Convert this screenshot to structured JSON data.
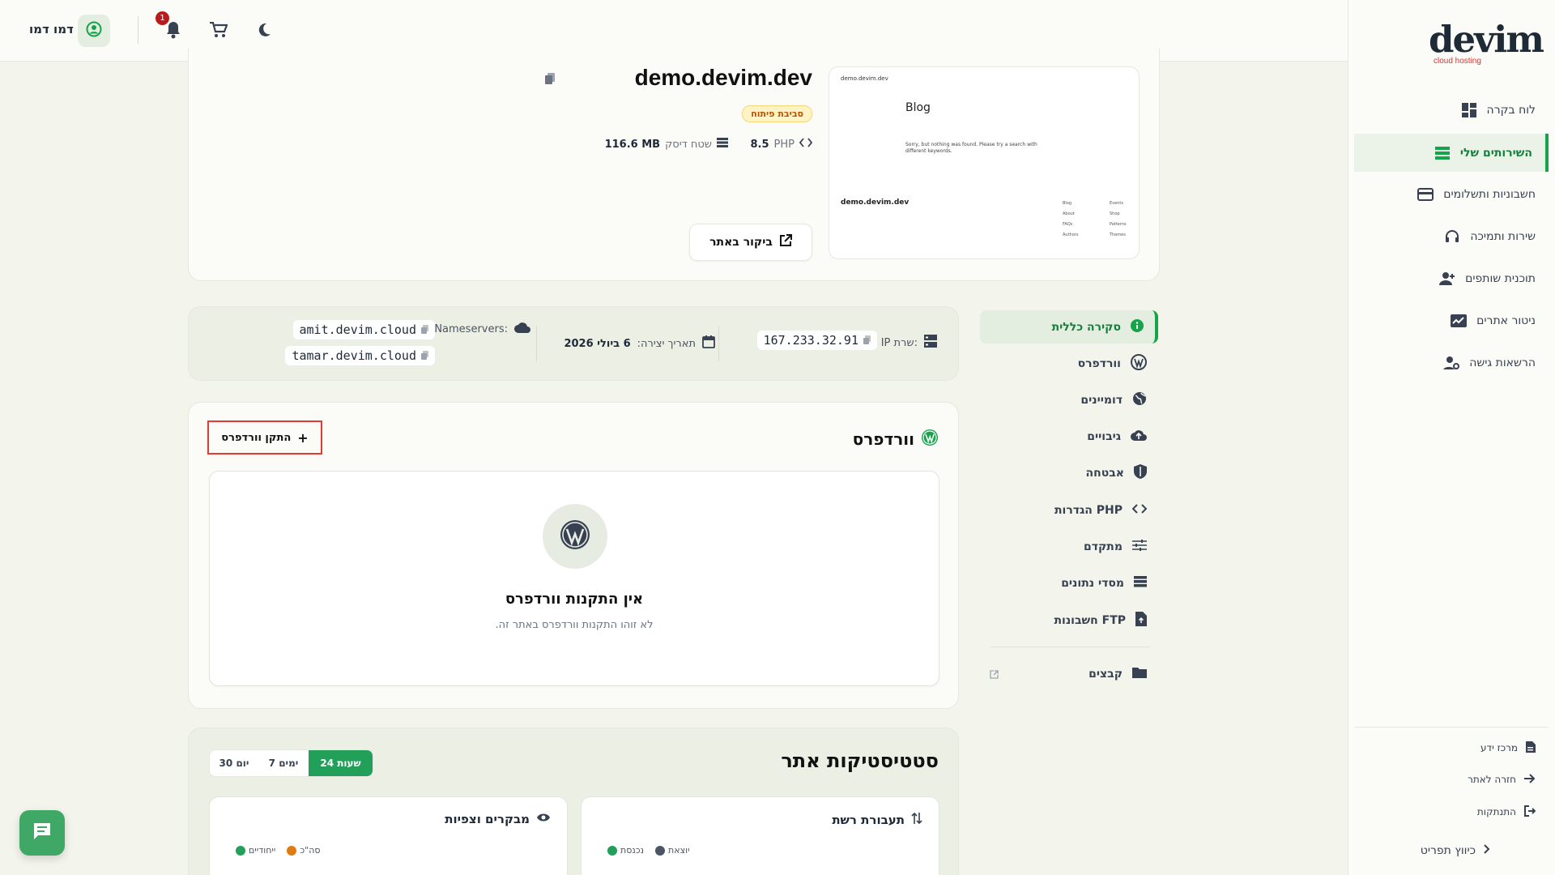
{
  "app": {
    "logo_text": "devim",
    "logo_sub": "cloud hosting"
  },
  "sidebar": {
    "items": [
      {
        "label": "לוח בקרה",
        "icon": "dashboard-icon"
      },
      {
        "label": "השירותים שלי",
        "icon": "services-icon"
      },
      {
        "label": "חשבוניות ותשלומים",
        "icon": "credit-card-icon"
      },
      {
        "label": "שירות ותמיכה",
        "icon": "headset-icon"
      },
      {
        "label": "תוכנית שותפים",
        "icon": "add-user-icon"
      },
      {
        "label": "ניטור אתרים",
        "icon": "monitor-chart-icon"
      },
      {
        "label": "הרשאות גישה",
        "icon": "user-gear-icon"
      }
    ],
    "footer": [
      {
        "label": "מרכז ידע"
      },
      {
        "label": "חזרה לאתר"
      },
      {
        "label": "התנתקות"
      }
    ],
    "collapse_label": "כיווץ תפריט"
  },
  "topbar": {
    "user_name": "דמו דמו",
    "notification_count": "1"
  },
  "site": {
    "domain": "demo.devim.dev",
    "env_badge": "סביבת פיתוח",
    "php_label": "PHP",
    "php_version": "8.5",
    "disk_label": "שטח דיסק",
    "disk_value": "116.6 MB",
    "visit_label": "ביקור באתר",
    "preview": {
      "site_small": "demo.devim.dev",
      "blog_title": "Blog",
      "blog_text": "Sorry, but nothing was found. Please try a search with different keywords.",
      "footer_site": "demo.devim.dev",
      "links_a": [
        "Blog",
        "About",
        "FAQs",
        "Authors"
      ],
      "links_b": [
        "Events",
        "Shop",
        "Patterns",
        "Themes"
      ]
    }
  },
  "info": {
    "ip_label": "IP שרת:",
    "ip_value": "167.233.32.91",
    "created_label": "תאריך יצירה:",
    "created_value": "6 ביולי 2026",
    "ns_label": "Nameservers:",
    "ns_values": [
      "amit.devim.cloud",
      "tamar.devim.cloud"
    ]
  },
  "submenu": [
    {
      "label": "סקירה כללית"
    },
    {
      "label": "וורדפרס"
    },
    {
      "label": "דומיינים"
    },
    {
      "label": "גיבויים"
    },
    {
      "label": "אבטחה"
    },
    {
      "label": "הגדרות PHP"
    },
    {
      "label": "מתקדם"
    },
    {
      "label": "מסדי נתונים"
    },
    {
      "label": "חשבונות FTP"
    },
    {
      "label": "קבצים"
    }
  ],
  "wordpress": {
    "title": "וורדפרס",
    "install_button": "התקן וורדפרס",
    "empty_title": "אין התקנות וורדפרס",
    "empty_text": "לא זוהו התקנות וורדפרס באתר זה."
  },
  "stats": {
    "title": "סטטיסטיקות אתר",
    "ranges": [
      "30 יום",
      "7 ימים",
      "24 שעות"
    ],
    "active_range": "24 שעות",
    "traffic": {
      "title": "תעבורת רשת",
      "legend": [
        {
          "label": "יוצאת",
          "color": "#4b5563"
        },
        {
          "label": "נכנסת",
          "color": "#22a05a"
        }
      ]
    },
    "visits": {
      "title": "מבקרים וצפיות",
      "legend": [
        {
          "label": "סה\"כ",
          "color": "#e07b12"
        },
        {
          "label": "ייחודיים",
          "color": "#22a05a"
        }
      ]
    }
  },
  "colors": {
    "accent": "#16a34a",
    "highlight_box": "#e53935",
    "badge_bg": "#fdf3c4",
    "badge_text": "#b45309"
  }
}
